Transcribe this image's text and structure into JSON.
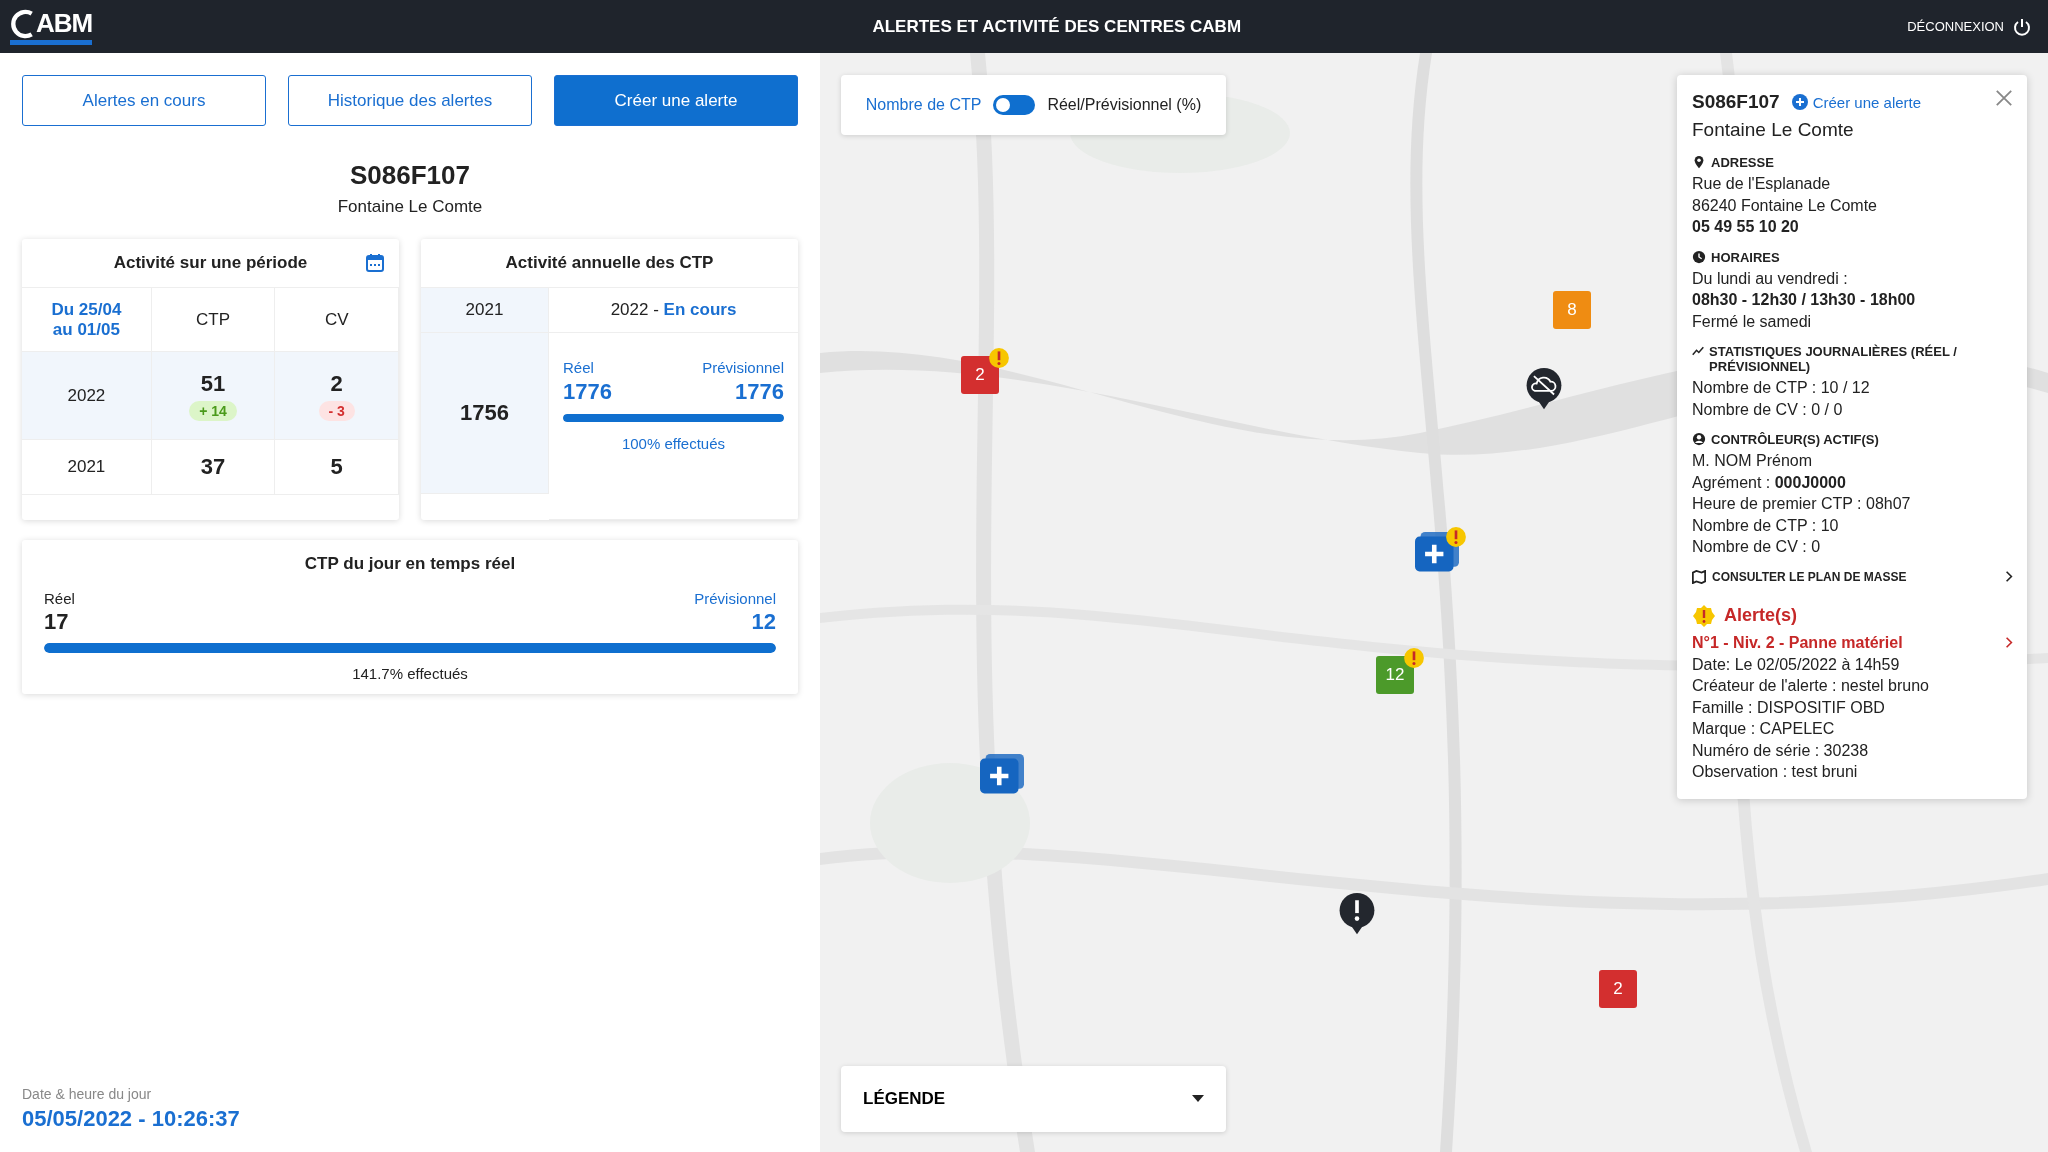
{
  "header": {
    "logo": "ABM",
    "title": "ALERTES ET ACTIVITÉ DES CENTRES CABM",
    "logout": "DÉCONNEXION"
  },
  "actions": [
    {
      "label": "Alertes en cours",
      "kind": "outline"
    },
    {
      "label": "Historique des alertes",
      "kind": "outline"
    },
    {
      "label": "Créer une alerte",
      "kind": "primary"
    }
  ],
  "centre": {
    "code": "S086F107",
    "name": "Fontaine Le Comte"
  },
  "period_card": {
    "title": "Activité sur une période",
    "period": "Du 25/04 au 01/05",
    "columns": [
      "CTP",
      "CV"
    ],
    "rows": [
      {
        "year": "2022",
        "highlight": true,
        "ctp": "51",
        "cv": "2",
        "ctp_delta": {
          "text": "+ 14",
          "kind": "increase"
        },
        "cv_delta": {
          "text": "- 3",
          "kind": "decrease"
        }
      },
      {
        "year": "2021",
        "highlight": false,
        "ctp": "37",
        "cv": "5"
      }
    ]
  },
  "annual_card": {
    "title": "Activité annuelle des CTP",
    "prev_year": "2021",
    "current_year": "2022 -",
    "current_status": "En cours",
    "prev_value": "1756",
    "real_label": "Réel",
    "real_value": "1776",
    "forecast_label": "Prévisionnel",
    "forecast_value": "1776",
    "level": 1.0,
    "done": "100% effectués"
  },
  "realtime_card": {
    "title": "CTP du jour en temps réel",
    "real_label": "Réel",
    "real_value": "17",
    "forecast_label": "Prévisionnel",
    "forecast_value": "12",
    "level": 1.0,
    "done": "141.7% effectués"
  },
  "footer": {
    "label": "Date & heure du jour",
    "datetime": "05/05/2022 - 10:26:37"
  },
  "map": {
    "toggle": {
      "left_label": "Nombre de CTP",
      "right_label": "Réel/Prévisionnel (%)",
      "on": false
    },
    "legend": {
      "label": "LÉGENDE",
      "expanded": false
    },
    "markers": [
      {
        "kind": "count",
        "label": "2",
        "color": "#d32f2f",
        "warning": true
      },
      {
        "kind": "count",
        "label": "8",
        "color": "#ef8c12",
        "warning": false
      },
      {
        "kind": "offline",
        "color": "#23272e",
        "warning": false
      },
      {
        "kind": "plus",
        "color": "#1565c0",
        "warning": true
      },
      {
        "kind": "count",
        "label": "12",
        "color": "#4c9a2a",
        "warning": true
      },
      {
        "kind": "plus",
        "color": "#1565c0",
        "warning": false
      },
      {
        "kind": "alert",
        "color": "#23272e",
        "warning": false
      },
      {
        "kind": "count",
        "label": "2",
        "color": "#d32f2f",
        "warning": false
      }
    ]
  },
  "info_panel": {
    "code": "S086F107",
    "create_link": "Créer une alerte",
    "name": "Fontaine Le Comte",
    "sections": [
      {
        "title": "ADRESSE",
        "lines": [
          {
            "text": "Rue de l'Esplanade",
            "bold": false
          },
          {
            "text": "86240 Fontaine Le Comte",
            "bold": false
          },
          {
            "text": "05 49 55 10 20",
            "bold": true
          }
        ]
      },
      {
        "title": "HORAIRES",
        "lines": [
          {
            "text": "Du lundi au vendredi :",
            "bold": false
          },
          {
            "text": "08h30 - 12h30 / 13h30 - 18h00",
            "bold": true
          },
          {
            "text": "Fermé le samedi",
            "bold": false
          }
        ]
      },
      {
        "title": "STATISTIQUES JOURNALIÈRES (RÉEL / PRÉVISIONNEL)",
        "lines": [
          {
            "text": "Nombre de CTP : 10 / 12",
            "bold": false
          },
          {
            "text": "Nombre de CV : 0 / 0",
            "bold": false
          }
        ]
      },
      {
        "title": "CONTRÔLEUR(S) ACTIF(S)",
        "lines": [
          {
            "text": "M. NOM Prénom",
            "bold": false
          },
          {
            "text": "Agrément : **000J0000**",
            "bold": false
          },
          {
            "text": "Heure de premier CTP : 08h07",
            "bold": false
          },
          {
            "text": "Nombre de CTP : 10",
            "bold": false
          },
          {
            "text": "Nombre de CV : 0",
            "bold": false
          }
        ]
      }
    ],
    "plan_link": "CONSULTER LE PLAN DE MASSE",
    "alerts_title": "Alerte(s)",
    "alerts": [
      {
        "title": "N°1 - Niv. 2 - Panne matériel",
        "lines": [
          "Date: Le 02/05/2022 à 14h59",
          "Créateur de l'alerte : nestel bruno",
          "Famille : DISPOSITIF OBD",
          "Marque : CAPELEC",
          "Numéro de série : 30238",
          "Observation : test bruni"
        ]
      }
    ]
  }
}
